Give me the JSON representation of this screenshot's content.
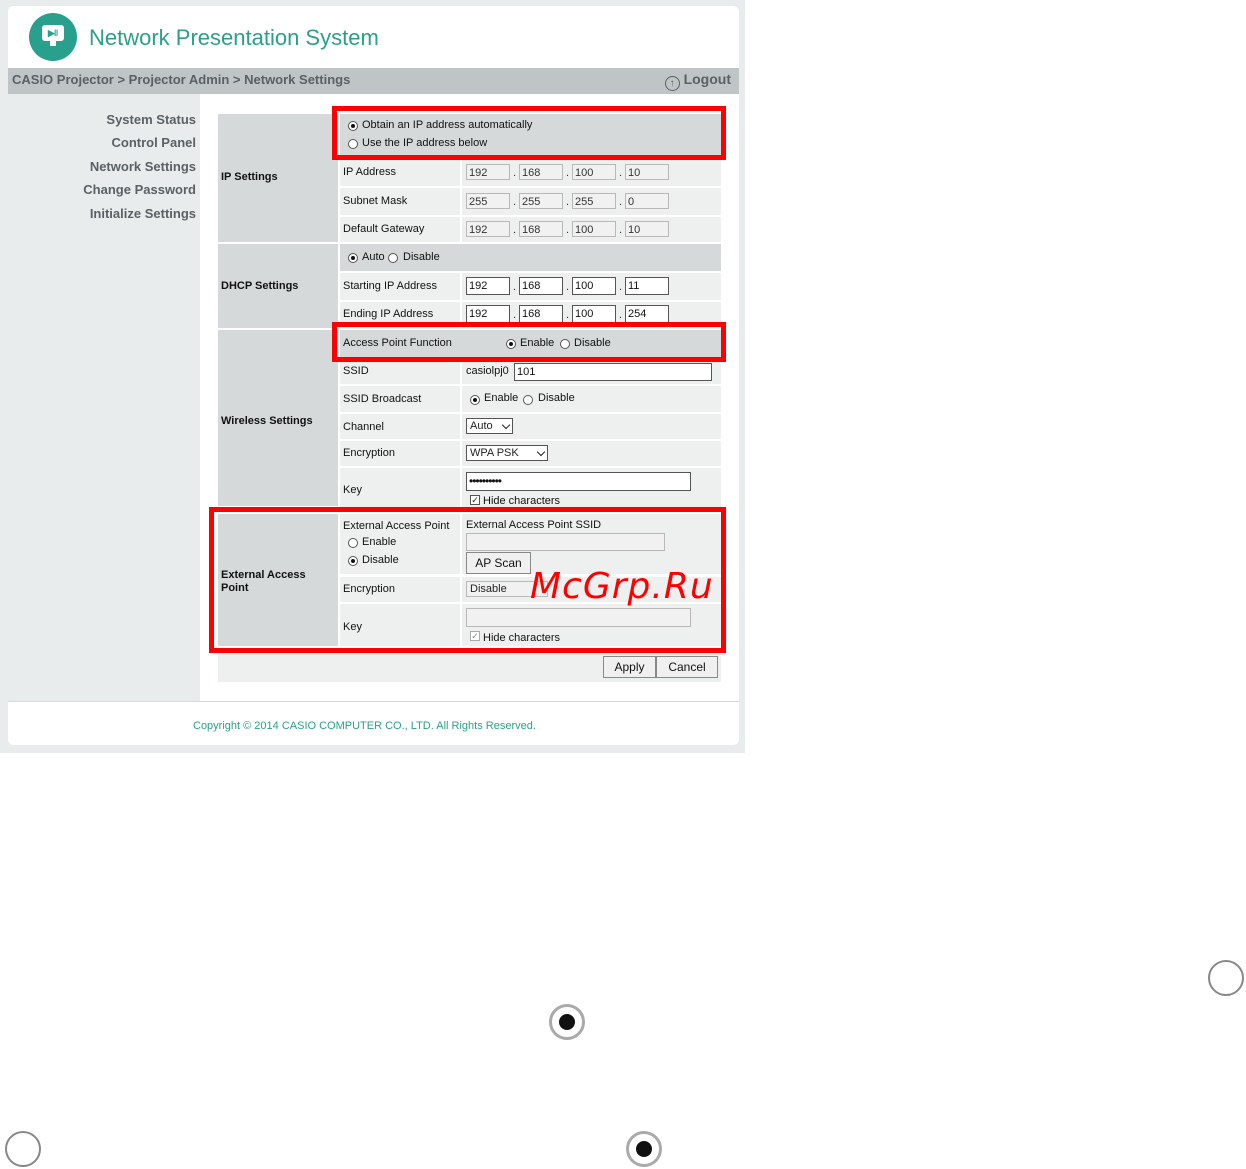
{
  "app": {
    "title": "Network Presentation System"
  },
  "breadcrumb": "CASIO Projector > Projector Admin > Network Settings",
  "logout_label": "Logout",
  "sidebar": {
    "items": [
      {
        "label": "System Status"
      },
      {
        "label": "Control Panel"
      },
      {
        "label": "Network Settings"
      },
      {
        "label": "Change Password"
      },
      {
        "label": "Initialize Settings"
      }
    ]
  },
  "ip_settings": {
    "section": "IP Settings",
    "auto_label": "Obtain an IP address automatically",
    "manual_label": "Use the IP address below",
    "selected": "auto",
    "ip_label": "IP Address",
    "ip": [
      "192",
      "168",
      "100",
      "10"
    ],
    "mask_label": "Subnet Mask",
    "mask": [
      "255",
      "255",
      "255",
      "0"
    ],
    "gw_label": "Default Gateway",
    "gw": [
      "192",
      "168",
      "100",
      "10"
    ]
  },
  "dhcp": {
    "section": "DHCP Settings",
    "auto_label": "Auto",
    "disable_label": "Disable",
    "start_label": "Starting IP Address",
    "start": [
      "192",
      "168",
      "100",
      "11"
    ],
    "end_label": "Ending IP Address",
    "end": [
      "192",
      "168",
      "100",
      "254"
    ]
  },
  "wireless": {
    "section": "Wireless Settings",
    "ap_label": "Access Point Function",
    "enable_label": "Enable",
    "disable_label": "Disable",
    "ssid_label": "SSID",
    "ssid_prefix": "casiolpj0",
    "ssid_value": "101",
    "broadcast_label": "SSID Broadcast",
    "channel_label": "Channel",
    "channel_value": "Auto",
    "encryption_label": "Encryption",
    "encryption_value": "WPA PSK",
    "key_label": "Key",
    "key_value": "••••••••••",
    "hide_label": "Hide characters"
  },
  "external": {
    "section": "External Access Point",
    "eap_label": "External Access Point",
    "enable_label": "Enable",
    "disable_label": "Disable",
    "ssid_label": "External Access Point SSID",
    "scan_label": "AP Scan",
    "encryption_label": "Encryption",
    "encryption_value": "Disable",
    "key_label": "Key",
    "hide_label": "Hide characters"
  },
  "buttons": {
    "apply": "Apply",
    "cancel": "Cancel"
  },
  "footer": {
    "copyright": "Copyright © 2014 CASIO COMPUTER CO., LTD. All Rights Reserved."
  },
  "watermark": "McGrp.Ru",
  "colors": {
    "brand": "#2aa08a",
    "highlight": "#ff0000"
  }
}
